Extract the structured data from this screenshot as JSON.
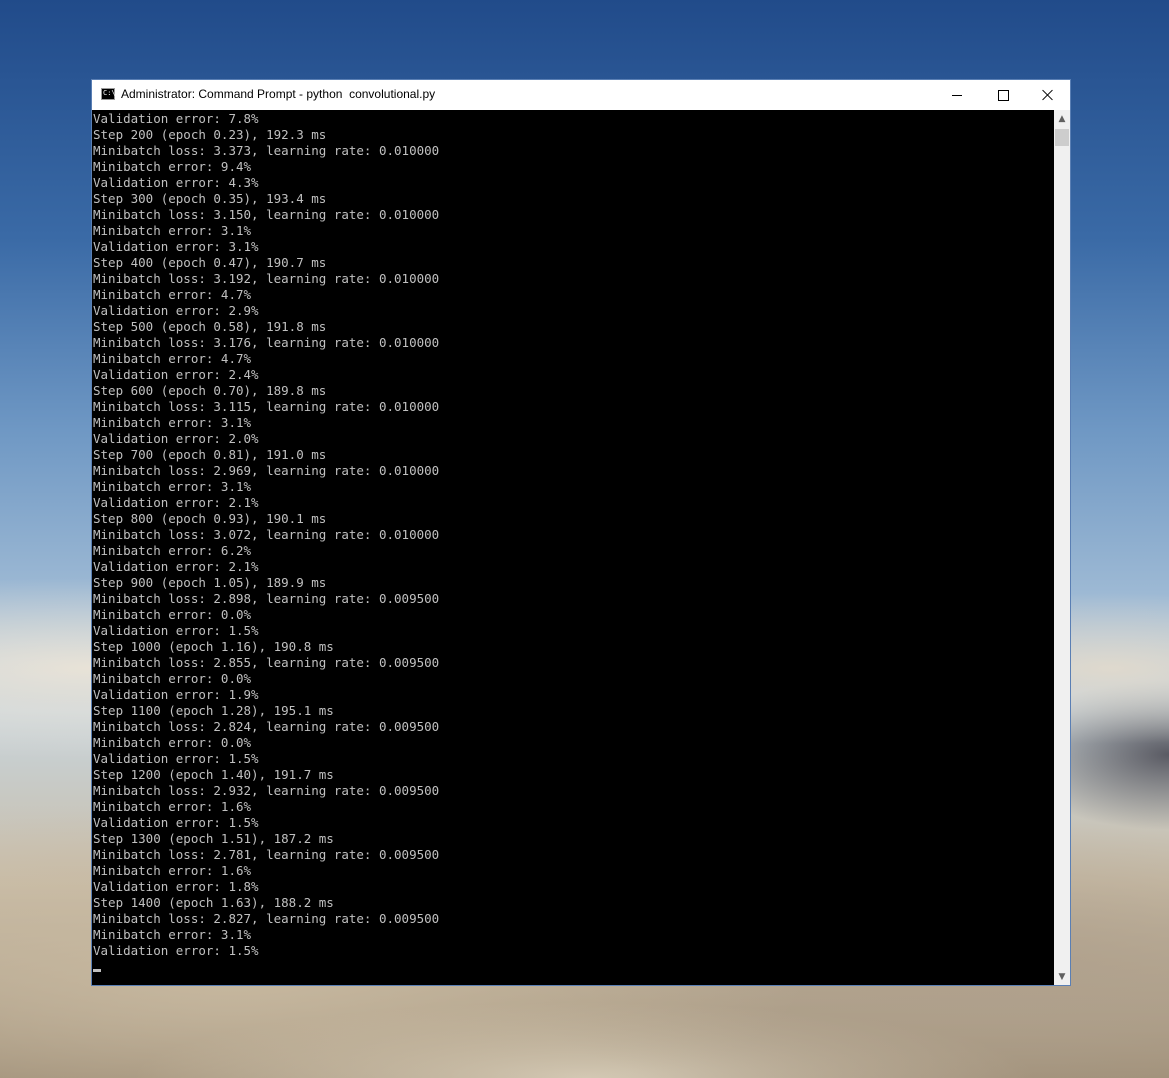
{
  "window": {
    "title": "Administrator: Command Prompt - python  convolutional.py",
    "icon": "command-prompt-icon",
    "icon_glyph": "C:\\",
    "accent": "#5a7fb4"
  },
  "controls": {
    "minimize_icon": "minimize-icon",
    "maximize_icon": "maximize-icon",
    "close_icon": "close-icon"
  },
  "scrollbar": {
    "up_glyph": "▲",
    "down_glyph": "▼"
  },
  "console": {
    "foreground": "#c0c0c0",
    "background": "#000000",
    "lines": [
      "Validation error: 7.8%",
      "Step 200 (epoch 0.23), 192.3 ms",
      "Minibatch loss: 3.373, learning rate: 0.010000",
      "Minibatch error: 9.4%",
      "Validation error: 4.3%",
      "Step 300 (epoch 0.35), 193.4 ms",
      "Minibatch loss: 3.150, learning rate: 0.010000",
      "Minibatch error: 3.1%",
      "Validation error: 3.1%",
      "Step 400 (epoch 0.47), 190.7 ms",
      "Minibatch loss: 3.192, learning rate: 0.010000",
      "Minibatch error: 4.7%",
      "Validation error: 2.9%",
      "Step 500 (epoch 0.58), 191.8 ms",
      "Minibatch loss: 3.176, learning rate: 0.010000",
      "Minibatch error: 4.7%",
      "Validation error: 2.4%",
      "Step 600 (epoch 0.70), 189.8 ms",
      "Minibatch loss: 3.115, learning rate: 0.010000",
      "Minibatch error: 3.1%",
      "Validation error: 2.0%",
      "Step 700 (epoch 0.81), 191.0 ms",
      "Minibatch loss: 2.969, learning rate: 0.010000",
      "Minibatch error: 3.1%",
      "Validation error: 2.1%",
      "Step 800 (epoch 0.93), 190.1 ms",
      "Minibatch loss: 3.072, learning rate: 0.010000",
      "Minibatch error: 6.2%",
      "Validation error: 2.1%",
      "Step 900 (epoch 1.05), 189.9 ms",
      "Minibatch loss: 2.898, learning rate: 0.009500",
      "Minibatch error: 0.0%",
      "Validation error: 1.5%",
      "Step 1000 (epoch 1.16), 190.8 ms",
      "Minibatch loss: 2.855, learning rate: 0.009500",
      "Minibatch error: 0.0%",
      "Validation error: 1.9%",
      "Step 1100 (epoch 1.28), 195.1 ms",
      "Minibatch loss: 2.824, learning rate: 0.009500",
      "Minibatch error: 0.0%",
      "Validation error: 1.5%",
      "Step 1200 (epoch 1.40), 191.7 ms",
      "Minibatch loss: 2.932, learning rate: 0.009500",
      "Minibatch error: 1.6%",
      "Validation error: 1.5%",
      "Step 1300 (epoch 1.51), 187.2 ms",
      "Minibatch loss: 2.781, learning rate: 0.009500",
      "Minibatch error: 1.6%",
      "Validation error: 1.8%",
      "Step 1400 (epoch 1.63), 188.2 ms",
      "Minibatch loss: 2.827, learning rate: 0.009500",
      "Minibatch error: 3.1%",
      "Validation error: 1.5%"
    ]
  }
}
